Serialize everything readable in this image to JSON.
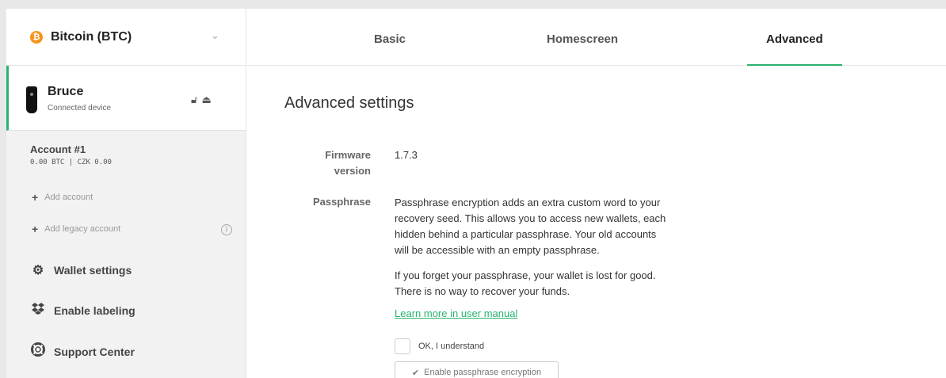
{
  "coin": {
    "label": "Bitcoin (BTC)",
    "icon": "bitcoin-icon",
    "color": "#f7931a"
  },
  "device": {
    "name": "Bruce",
    "status": "Connected device"
  },
  "account": {
    "name": "Account #1",
    "balance": "0.00 BTC | CZK 0.00"
  },
  "sidebar": {
    "add_account": "Add account",
    "add_legacy_account": "Add legacy account",
    "wallet_settings": "Wallet settings",
    "enable_labeling": "Enable labeling",
    "support_center": "Support Center"
  },
  "tabs": [
    {
      "label": "Basic"
    },
    {
      "label": "Homescreen"
    },
    {
      "label": "Advanced",
      "active": true
    }
  ],
  "accent_color": "#2ab36e",
  "content": {
    "title": "Advanced settings",
    "firmware_label_1": "Firmware",
    "firmware_label_2": "version",
    "firmware_value": "1.7.3",
    "passphrase_label": "Passphrase",
    "passphrase_line1": "Passphrase encryption adds an extra custom word to your",
    "passphrase_line2": "recovery seed. This allows you to access new wallets, each",
    "passphrase_line3": "hidden behind a particular passphrase. Your old accounts",
    "passphrase_line4": "will be accessible with an empty passphrase.",
    "warning_line1": "If you forget your passphrase, your wallet is lost for good.",
    "warning_line2": "There is no way to recover your funds.",
    "learn_more": "Learn more in user manual",
    "understand_label": "OK, I understand",
    "enable_button": "Enable passphrase encryption"
  }
}
